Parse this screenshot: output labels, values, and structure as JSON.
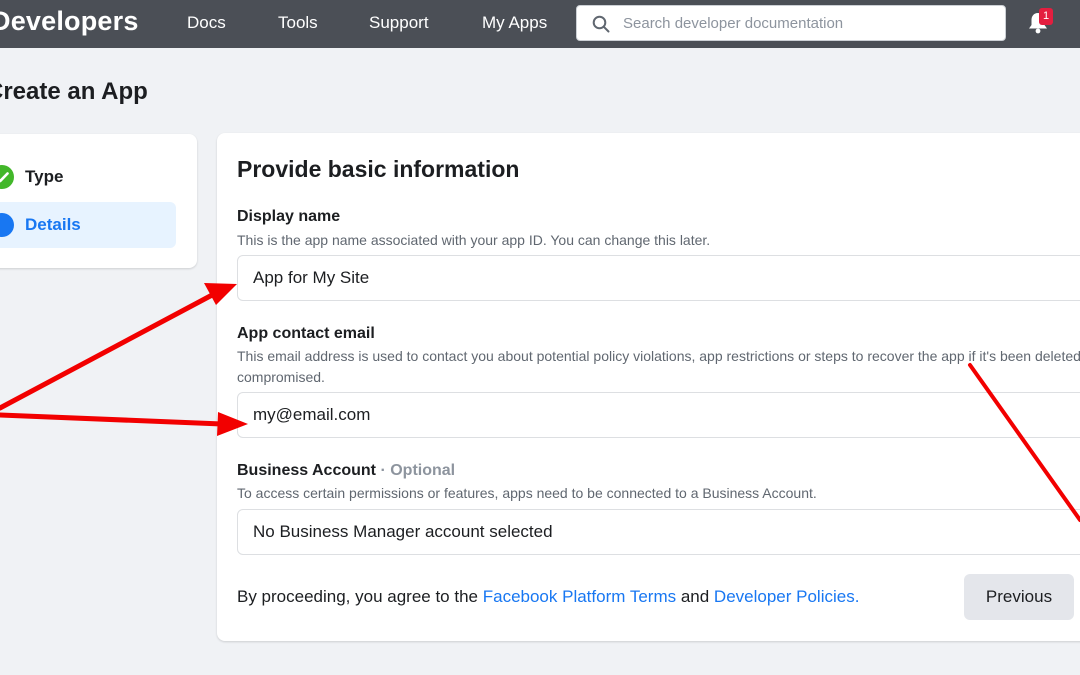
{
  "nav": {
    "brand": "Developers",
    "links": [
      "Docs",
      "Tools",
      "Support",
      "My Apps"
    ],
    "search_placeholder": "Search developer documentation",
    "notification_count": "1"
  },
  "page": {
    "title": "Create an App"
  },
  "stepper": {
    "steps": [
      {
        "label": "Type",
        "state": "complete",
        "icon": "check-icon"
      },
      {
        "label": "Details",
        "state": "active",
        "icon": "step-dot-icon"
      }
    ]
  },
  "form": {
    "title": "Provide basic information",
    "display_name": {
      "label": "Display name",
      "help": "This is the app name associated with your app ID. You can change this later.",
      "value": "App for My Site"
    },
    "contact_email": {
      "label": "App contact email",
      "help_line1": "This email address is used to contact you about potential policy violations, app restrictions or steps to recover the app if it's been deleted or",
      "help_line2": "compromised.",
      "value": "my@email.com"
    },
    "business_account": {
      "label": "Business Account",
      "optional": "· Optional",
      "help": "To access certain permissions or features, apps need to be connected to a Business Account.",
      "value": "No Business Manager account selected"
    },
    "footer": {
      "prefix": "By proceeding, you agree to the ",
      "link1": "Facebook Platform Terms",
      "middle": " and ",
      "link2": "Developer Policies",
      "suffix": "."
    },
    "previous_label": "Previous"
  },
  "colors": {
    "nav_bg": "#4b4f56",
    "accent": "#1877f2",
    "success": "#42b72a",
    "badge": "#e41e3f",
    "annotation": "#ff0000"
  }
}
